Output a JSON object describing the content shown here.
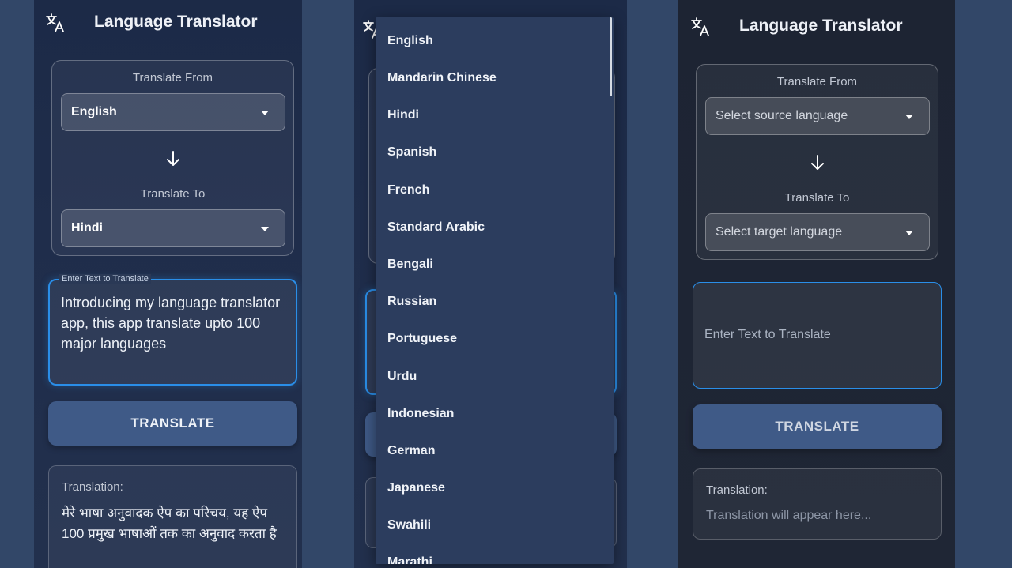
{
  "app": {
    "title": "Language Translator",
    "logo_icon": "translate-icon"
  },
  "screens": {
    "filled": {
      "from_label": "Translate From",
      "from_value": "English",
      "to_label": "Translate To",
      "to_value": "Hindi",
      "input_legend": "Enter Text to Translate",
      "input_text": "Introducing my language translator app, this app translate upto 100 major languages",
      "button": "TRANSLATE",
      "output_label": "Translation:",
      "output_text": "मेरे भाषा अनुवादक ऐप का परिचय, यह ऐप 100 प्रमुख भाषाओं तक का अनुवाद करता है"
    },
    "dropdown": {
      "options": [
        "English",
        "Mandarin Chinese",
        "Hindi",
        "Spanish",
        "French",
        "Standard Arabic",
        "Bengali",
        "Russian",
        "Portuguese",
        "Urdu",
        "Indonesian",
        "German",
        "Japanese",
        "Swahili",
        "Marathi"
      ]
    },
    "empty": {
      "from_label": "Translate From",
      "from_placeholder": "Select source language",
      "to_label": "Translate To",
      "to_placeholder": "Select target language",
      "input_placeholder": "Enter Text to Translate",
      "button": "TRANSLATE",
      "output_label": "Translation:",
      "output_placeholder": "Translation will appear here..."
    }
  },
  "colors": {
    "accent": "#2a8ee8",
    "button": "#3f5a87",
    "background": "#324768"
  }
}
